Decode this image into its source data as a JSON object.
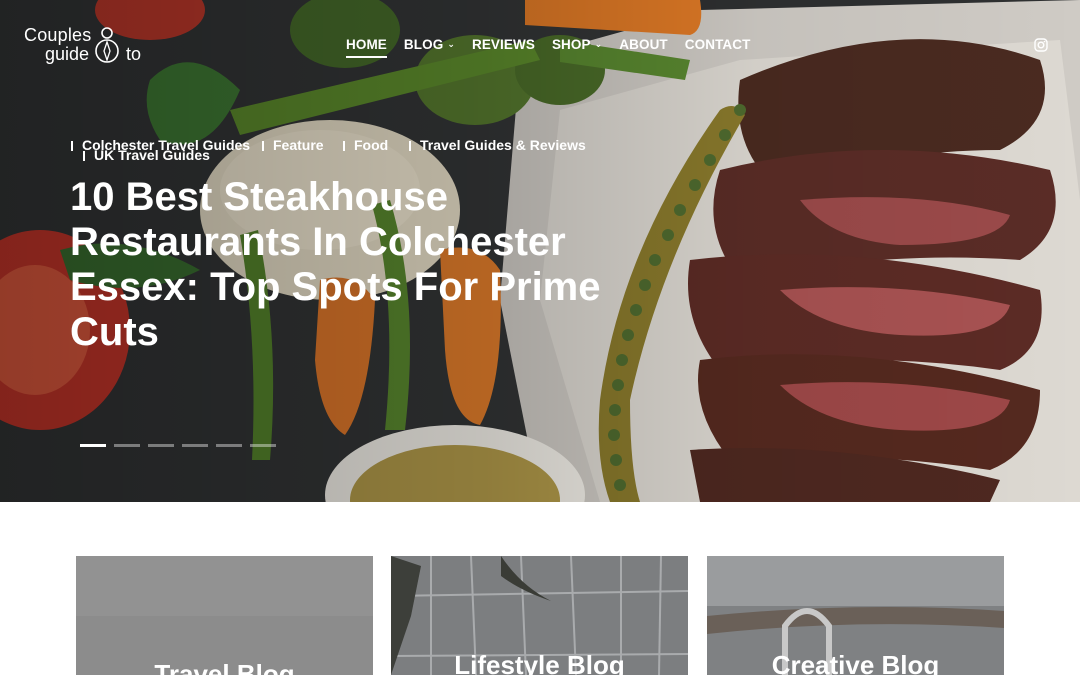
{
  "brand": {
    "line1": "Couples",
    "line2": "guide",
    "line3": "to"
  },
  "nav": {
    "items": [
      {
        "label": "HOME",
        "active": true,
        "dropdown": false
      },
      {
        "label": "BLOG",
        "active": false,
        "dropdown": true
      },
      {
        "label": "REVIEWS",
        "active": false,
        "dropdown": false
      },
      {
        "label": "SHOP",
        "active": false,
        "dropdown": true
      },
      {
        "label": "ABOUT",
        "active": false,
        "dropdown": false
      },
      {
        "label": "CONTACT",
        "active": false,
        "dropdown": false
      }
    ],
    "social_icon": "instagram-icon"
  },
  "hero": {
    "categories": [
      "Colchester Travel Guides",
      "Feature",
      "Food",
      "Travel Guides & Reviews",
      "UK Travel Guides"
    ],
    "title": "10 Best Steakhouse Restaurants In Colchester Essex: Top Spots For Prime Cuts",
    "slide_count": 6,
    "active_slide": 1
  },
  "cards": [
    {
      "label": "Travel Blog"
    },
    {
      "label": "Lifestyle Blog"
    },
    {
      "label": "Creative Blog"
    }
  ]
}
